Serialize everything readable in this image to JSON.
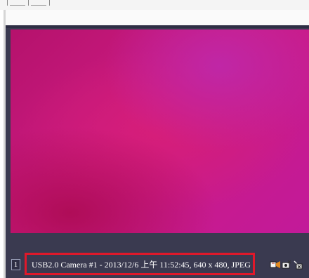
{
  "viewer": {
    "channel_number": "1",
    "caption": "USB2.0 Camera #1 - 2013/12/6 上午 11:52:45, 640 x 480, JPEG",
    "highlight_color": "#e0182a",
    "background_color": "#3a3a50",
    "feed_colors": [
      "#b5126c",
      "#cc1b82",
      "#c21a9a"
    ]
  },
  "toolbar": {
    "icons": [
      "record-icon",
      "snapshot-icon",
      "close-window-icon"
    ]
  }
}
